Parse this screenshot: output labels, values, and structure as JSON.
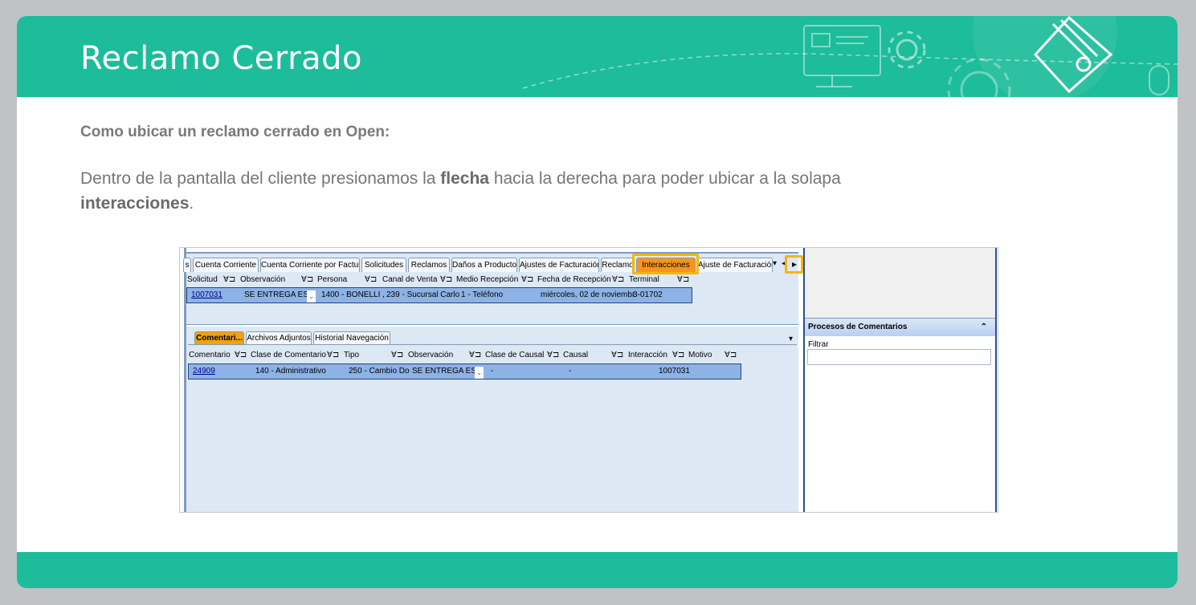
{
  "slide": {
    "title": "Reclamo Cerrado",
    "intro": "Como ubicar un reclamo cerrado en Open:",
    "body_pre": "Dentro de la pantalla del cliente presionamos la ",
    "body_bold1": "flecha",
    "body_mid": " hacia la derecha para poder ubicar a la solapa ",
    "body_bold2": "interacciones",
    "body_end": ".",
    "accent_color": "#1dbc9a"
  },
  "screenshot": {
    "tabs": [
      "s",
      "Cuenta Corriente",
      "Cuenta Corriente por Factura",
      "Solicitudes",
      "Reclamos",
      "Daños a Producto",
      "Ajustes de Facturación",
      "Reclamo",
      "Interacciones",
      "Ajuste de Facturación"
    ],
    "tab_overflow_icon": "▾",
    "scroll_left_icon": "◂",
    "scroll_right_icon": "▸",
    "columns": [
      "Solicitud",
      "Observación",
      "Persona",
      "Canal de Venta",
      "Medio Recepción",
      "Fecha de Recepción",
      "Terminal"
    ],
    "row": {
      "solicitud": "1007031",
      "observacion": "SE ENTREGA ES",
      "persona": "1400 - BONELLI ,",
      "canal": "239 - Sucursal Carlo",
      "medio": "1 - Teléfono",
      "fecha": "miércoles, 02 de noviembr",
      "terminal": "3-01702"
    },
    "subtabs": [
      "Comentari...",
      "Archivos Adjuntos",
      "Historial Navegación"
    ],
    "sub_columns": [
      "Comentario",
      "Clase de Comentario",
      "Tipo",
      "Observación",
      "Clase de Causal",
      "Causal",
      "Interacción",
      "Motivo"
    ],
    "sub_row": {
      "comentario": "24909",
      "clase": "140 - Administrativo",
      "tipo": "250 - Cambio Do",
      "observacion": "SE ENTREGA ES",
      "clase_causal": "-",
      "causal": "-",
      "interaccion": "1007031"
    },
    "right_panel": {
      "title": "Procesos de Comentarios",
      "collapse_icon": "⌃",
      "filter_label": "Filtrar"
    }
  }
}
